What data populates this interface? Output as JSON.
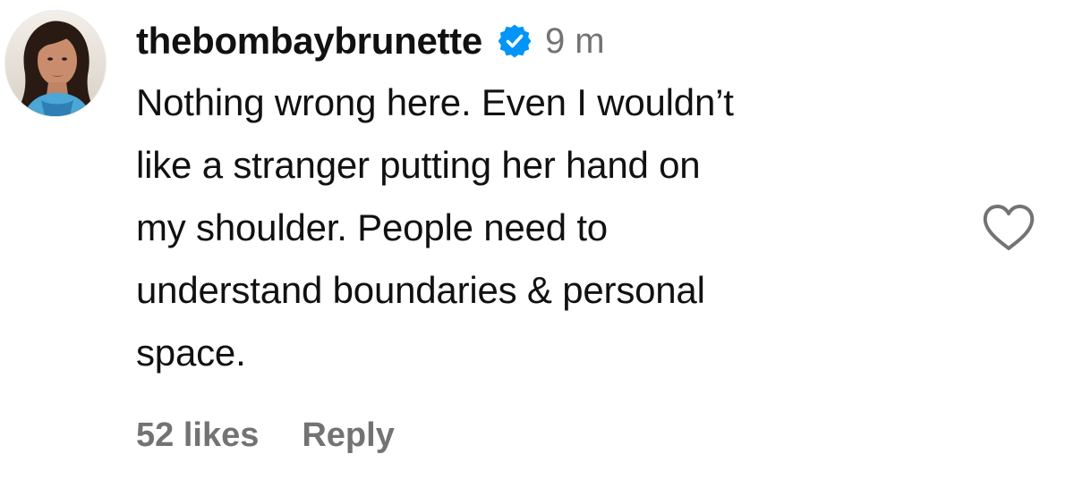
{
  "comment": {
    "avatar_icon": "profile-photo",
    "username": "thebombaybrunette",
    "verified_icon": "verified-badge-icon",
    "verified_color": "#0095f6",
    "time": "9 m",
    "text_lines": [
      "Nothing wrong here. Even I wouldn’t",
      "like a stranger putting her hand on",
      "my shoulder. People need to",
      "understand boundaries & personal",
      "space."
    ],
    "like_icon": "heart-icon",
    "likes": "52 likes",
    "reply_label": "Reply"
  }
}
